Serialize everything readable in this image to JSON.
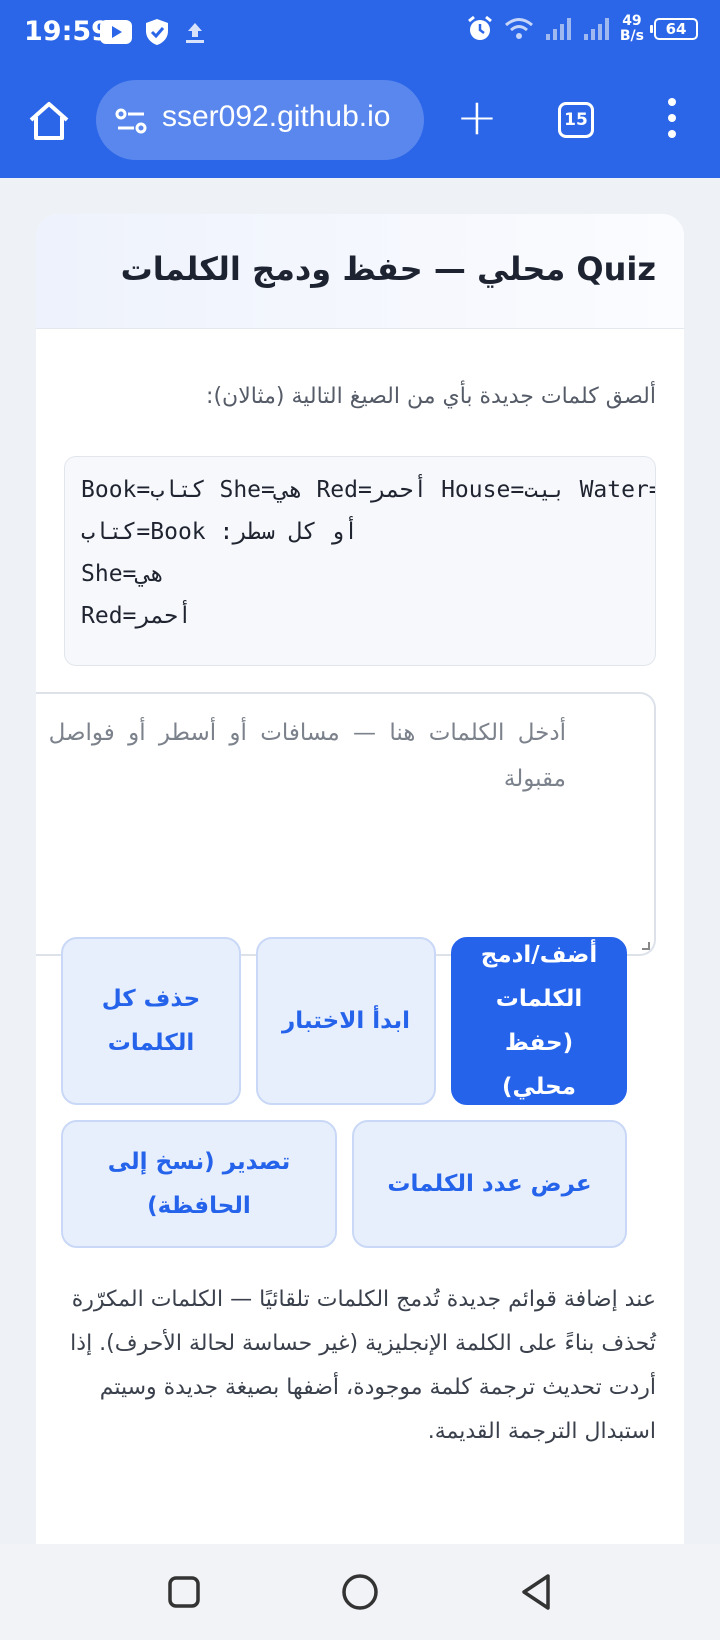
{
  "status_bar": {
    "time": "19:59",
    "net_speed_value": "49",
    "net_speed_unit": "B/s",
    "battery": "64",
    "icons": [
      "youtube-icon",
      "shield-icon",
      "upload-icon",
      "alarm-icon",
      "wifi-icon",
      "signal-icon",
      "signal-icon"
    ]
  },
  "browser": {
    "url": "sser092.github.io",
    "tab_count": "15",
    "icons": [
      "home-icon",
      "site-settings-icon",
      "new-tab-plus-icon",
      "tabs-icon",
      "more-menu-icon"
    ]
  },
  "card": {
    "title": "Quiz محلي — حفظ ودمج الكلمات",
    "instructions": "ألصق كلمات جديدة بأي من الصيغ التالية (مثالان):",
    "example_lines": [
      "Book=كتاب She=هي Red=أحمر House=بيت Water=",
      "أو كل سطر: Book=كتاب",
      "She=هي",
      "Red=أحمر"
    ],
    "textarea_placeholder": "أدخل الكلمات هنا — مسافات أو أسطر أو فواصل مقبولة",
    "buttons": {
      "add_merge": "أضف/ادمج الكلمات (حفظ محلي)",
      "start_quiz": "ابدأ الاختبار",
      "delete_all": "حذف كل الكلمات",
      "show_count": "عرض عدد الكلمات",
      "export": "تصدير (نسخ إلى الحافظة)"
    },
    "note": "عند إضافة قوائم جديدة تُدمج الكلمات تلقائيًا — الكلمات المكرّرة تُحذف بناءً على الكلمة الإنجليزية (غير حساسة لحالة الأحرف). إذا أردت تحديث ترجمة كلمة موجودة، أضفها بصيغة جديدة وسيتم استبدال الترجمة القديمة."
  },
  "colors": {
    "brand_blue": "#2b66e8",
    "primary_button": "#2563eb",
    "secondary_button_bg": "#e8effc"
  },
  "nav_bar": {
    "icons": [
      "recents-square-icon",
      "home-circle-icon",
      "back-triangle-icon"
    ]
  }
}
